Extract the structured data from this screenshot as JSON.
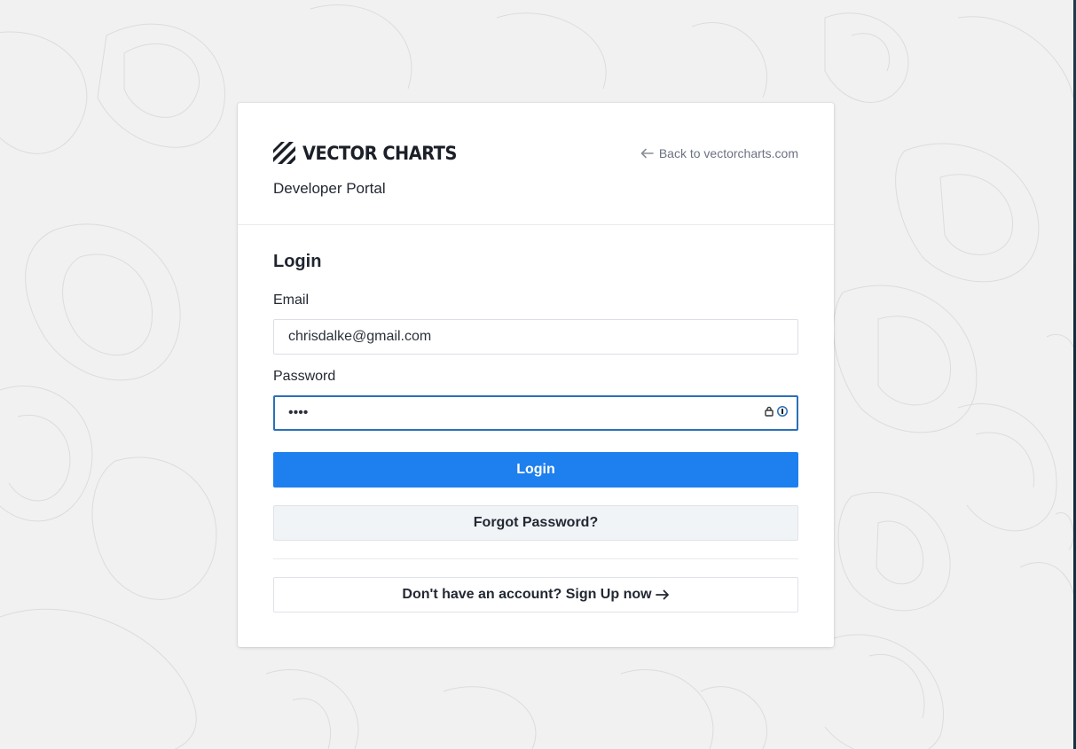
{
  "brand": {
    "name": "VECTOR CHARTS",
    "subtitle": "Developer Portal",
    "back_link": "Back to vectorcharts.com"
  },
  "login": {
    "title": "Login",
    "email_label": "Email",
    "email_value": "chrisdalke@gmail.com",
    "password_label": "Password",
    "password_value": "••••",
    "submit_label": "Login",
    "forgot_label": "Forgot Password?",
    "signup_label": "Don't have an account? Sign Up now"
  },
  "colors": {
    "primary": "#1e7fee",
    "focus_border": "#2b6fb8",
    "background": "#f1f1f1"
  },
  "icons": {
    "logo": "vector-charts-logo",
    "back": "arrow-left-icon",
    "password_manager": "password-manager-icon",
    "signup": "arrow-right-icon"
  }
}
